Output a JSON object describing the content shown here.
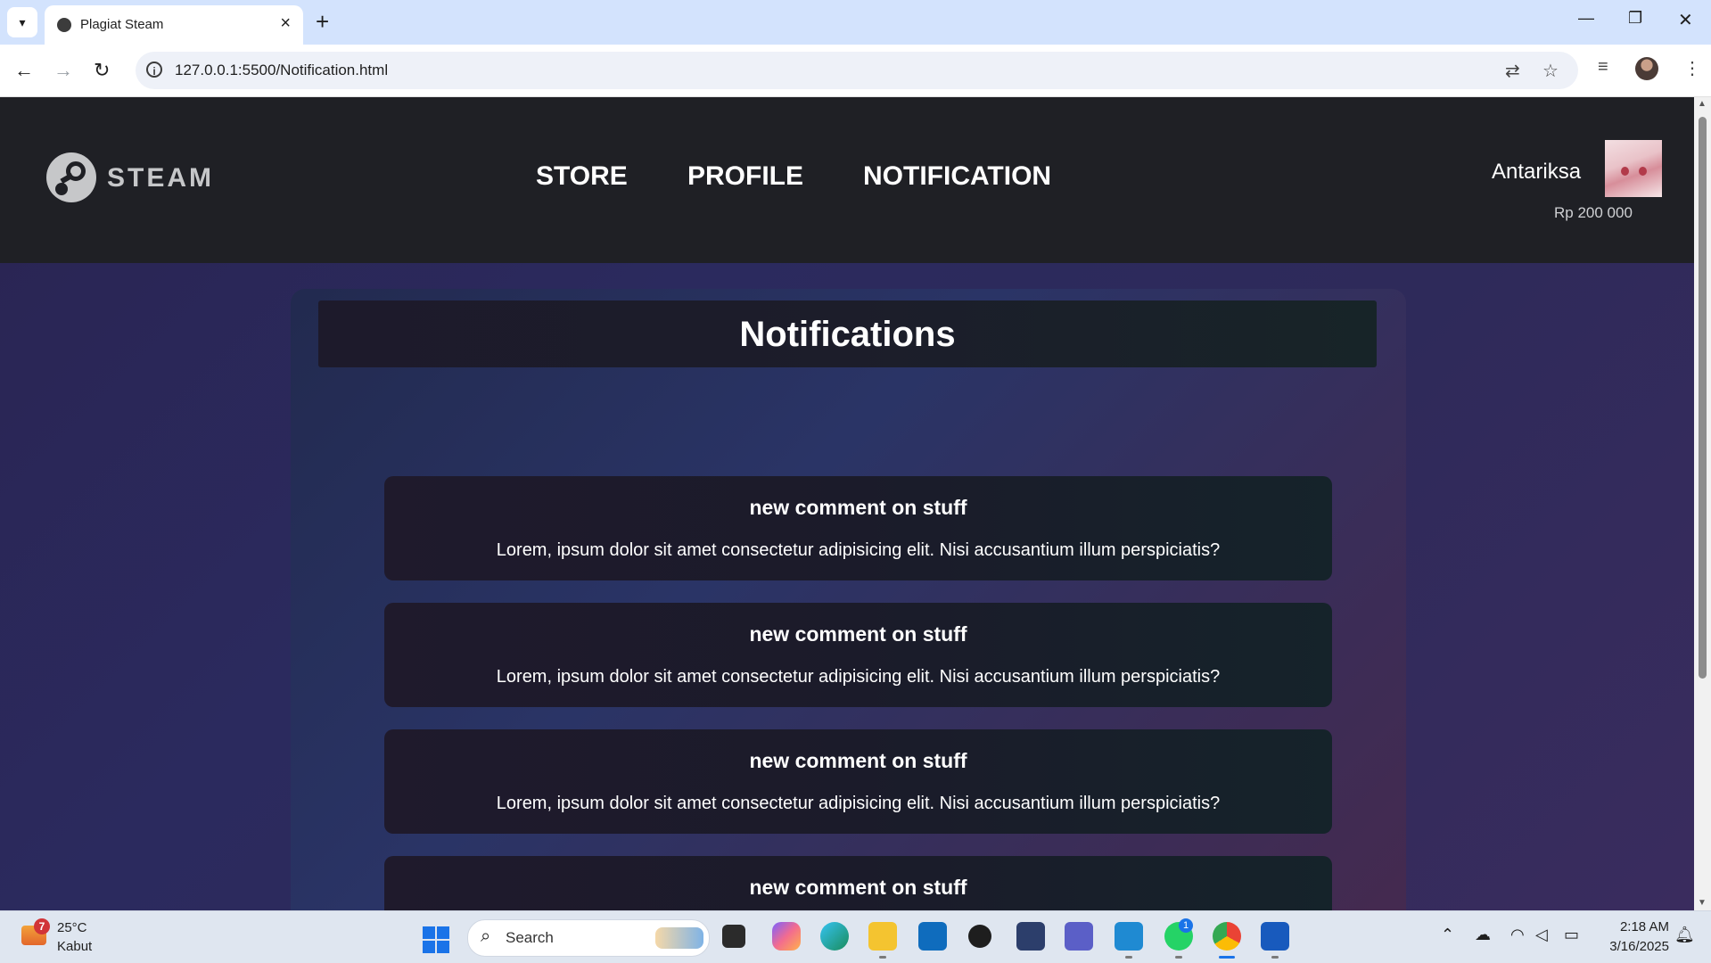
{
  "browser": {
    "tab_title": "Plagiat Steam",
    "url": "127.0.0.1:5500/Notification.html"
  },
  "site": {
    "logo_text": "STEAM",
    "nav": [
      {
        "label": "STORE"
      },
      {
        "label": "PROFILE"
      },
      {
        "label": "NOTIFICATION"
      }
    ],
    "user": {
      "name": "Antariksa",
      "balance": "Rp 200 000"
    }
  },
  "page": {
    "title": "Notifications",
    "notifications": [
      {
        "title": "new comment on stuff",
        "body": "Lorem, ipsum dolor sit amet consectetur adipisicing elit. Nisi accusantium illum perspiciatis?"
      },
      {
        "title": "new comment on stuff",
        "body": "Lorem, ipsum dolor sit amet consectetur adipisicing elit. Nisi accusantium illum perspiciatis?"
      },
      {
        "title": "new comment on stuff",
        "body": "Lorem, ipsum dolor sit amet consectetur adipisicing elit. Nisi accusantium illum perspiciatis?"
      },
      {
        "title": "new comment on stuff",
        "body": ""
      }
    ]
  },
  "taskbar": {
    "weather": {
      "temp": "25°C",
      "condition": "Kabut",
      "badge": "7"
    },
    "search_label": "Search",
    "whatsapp_badge": "1",
    "time": "2:18 AM",
    "date": "3/16/2025"
  }
}
